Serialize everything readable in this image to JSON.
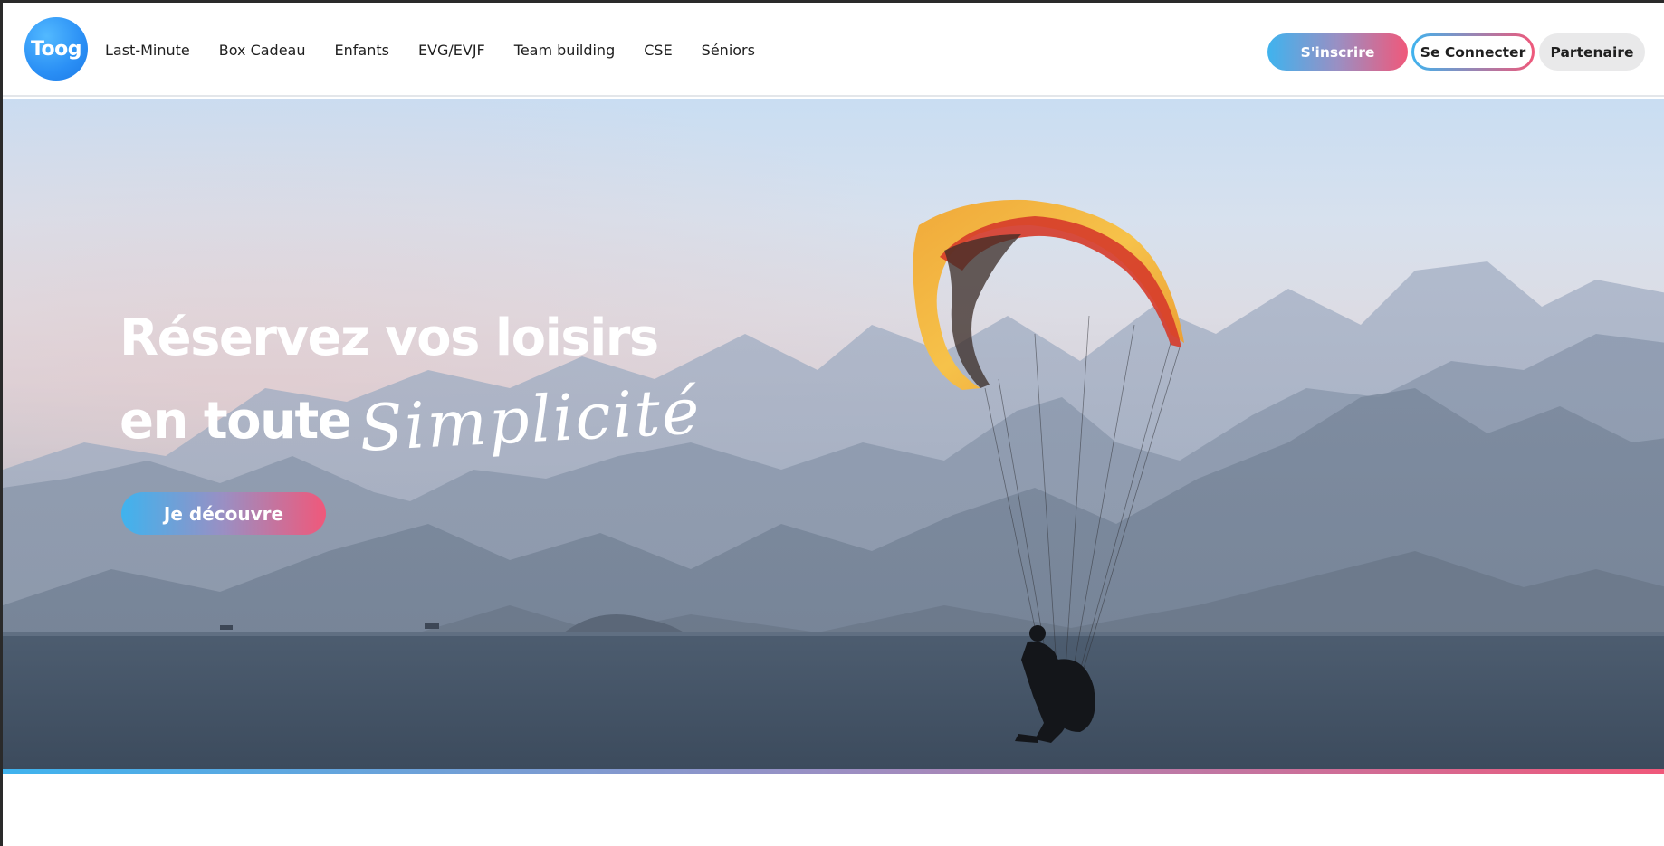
{
  "header": {
    "logo_text": "Toog",
    "nav": [
      {
        "label": "Last-Minute"
      },
      {
        "label": "Box Cadeau"
      },
      {
        "label": "Enfants"
      },
      {
        "label": "EVG/EVJF"
      },
      {
        "label": "Team building"
      },
      {
        "label": "CSE"
      },
      {
        "label": "Séniors"
      }
    ],
    "signup_label": "S'inscrire",
    "login_label": "Se Connecter",
    "partner_label": "Partenaire"
  },
  "hero": {
    "title_line1": "Réservez vos loisirs",
    "title_line2": "en toute",
    "title_script": "Simplicité",
    "cta_label": "Je découvre"
  },
  "colors": {
    "gradient_start": "#3fb3ee",
    "gradient_end": "#f0587a",
    "logo_blue": "#2a8ff5",
    "text_dark": "#1f1f1f"
  },
  "icons": {
    "logo": "toog-logo"
  }
}
